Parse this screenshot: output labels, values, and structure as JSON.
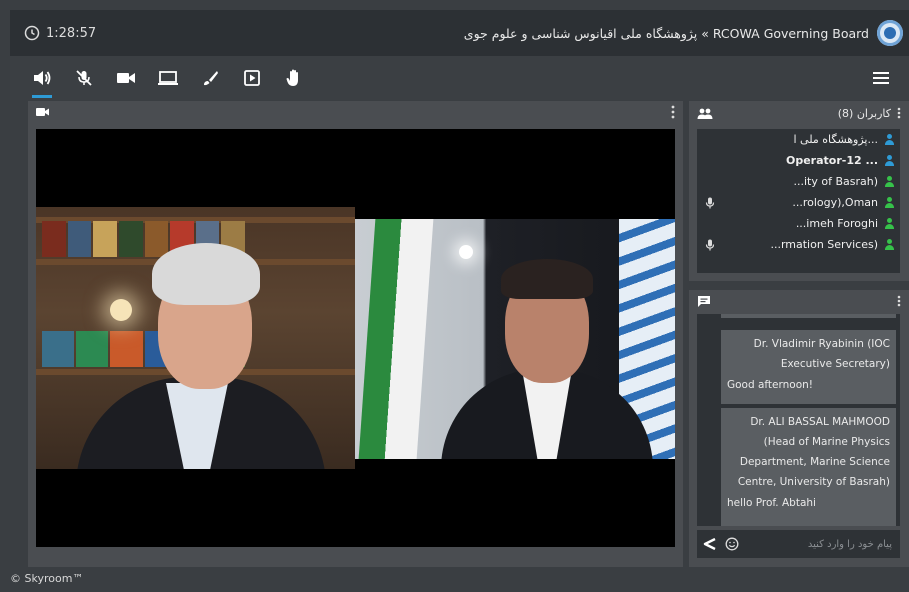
{
  "session": {
    "elapsed": "1:28:57",
    "title": "RCOWA Governing Board » پژوهشگاه ملی اقیانوس شناسی و علوم جوی"
  },
  "toolbar": {
    "items": [
      {
        "name": "speaker",
        "icon": "speaker-icon",
        "active": true
      },
      {
        "name": "microphone",
        "icon": "mic-off-icon"
      },
      {
        "name": "camera",
        "icon": "camera-icon"
      },
      {
        "name": "screen-share",
        "icon": "laptop-icon"
      },
      {
        "name": "whiteboard",
        "icon": "brush-icon"
      },
      {
        "name": "media",
        "icon": "play-box-icon"
      },
      {
        "name": "raise-hand",
        "icon": "hand-icon"
      }
    ],
    "menu_icon": "menu-icon"
  },
  "users": {
    "label": "کاربران (8)",
    "list": [
      {
        "name": "پژوهشگاه ملی ا...",
        "color": "#2e9bd6",
        "mic": false
      },
      {
        "name": "Operator-12 ...",
        "color": "#2e9bd6",
        "mic": false,
        "bold": true
      },
      {
        "name": "...ity of Basrah)",
        "color": "#36c24a",
        "mic": false
      },
      {
        "name": "...rology),Oman",
        "color": "#36c24a",
        "mic": true
      },
      {
        "name": "...imeh Foroghi",
        "color": "#36c24a",
        "mic": false
      },
      {
        "name": "...rmation Services)",
        "color": "#36c24a",
        "mic": true
      }
    ]
  },
  "chat": {
    "messages": [
      {
        "sender": "Dr. Vladimir Ryabinin (IOC Executive Secretary)",
        "text": "Good afternoon!"
      },
      {
        "sender": "Dr. ALI BASSAL MAHMOOD (Head of Marine Physics Department, Marine Science Centre, University of Basrah)",
        "text": "hello Prof. Abtahi"
      }
    ],
    "placeholder": "پیام خود را وارد کنید"
  },
  "footer": "© Skyroom™",
  "colors": {
    "accent": "#2e9bd6",
    "online": "#36c24a",
    "panel": "#4a4d51",
    "dark": "#2e3236"
  }
}
